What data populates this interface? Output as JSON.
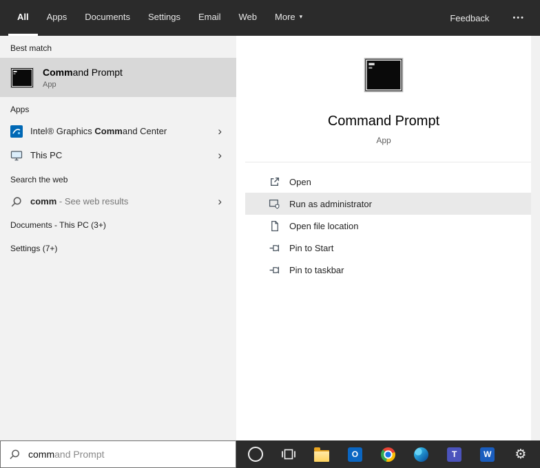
{
  "topbar": {
    "tabs": [
      {
        "label": "All",
        "active": true
      },
      {
        "label": "Apps"
      },
      {
        "label": "Documents"
      },
      {
        "label": "Settings"
      },
      {
        "label": "Email"
      },
      {
        "label": "Web"
      },
      {
        "label": "More",
        "caret": "▾"
      }
    ],
    "feedback_label": "Feedback",
    "more_options_glyph": "•••"
  },
  "left_panel": {
    "best_match_header": "Best match",
    "best_match": {
      "title_match": "Comm",
      "title_rest": "and Prompt",
      "subtitle": "App"
    },
    "apps_header": "Apps",
    "app_items": [
      {
        "pre": "Intel® Graphics ",
        "match": "Comm",
        "rest": "and Center",
        "chevron": "›"
      },
      {
        "pre": "This PC",
        "match": "",
        "rest": "",
        "chevron": "›"
      }
    ],
    "search_web_header": "Search the web",
    "search_web_item": {
      "match": "comm",
      "rest": " - See web results",
      "chevron": "›"
    },
    "group_headers": [
      {
        "label": "Documents - This PC (3+)"
      },
      {
        "label": "Settings (7+)"
      }
    ]
  },
  "right_panel": {
    "app_title": "Command Prompt",
    "app_subtitle": "App",
    "actions": [
      {
        "label": "Open"
      },
      {
        "label": "Run as administrator",
        "highlighted": true
      },
      {
        "label": "Open file location"
      },
      {
        "label": "Pin to Start"
      },
      {
        "label": "Pin to taskbar"
      }
    ]
  },
  "search_box": {
    "typed": "comm",
    "suggestion": "and Prompt"
  },
  "taskbar": {
    "icons": [
      {
        "name": "cortana"
      },
      {
        "name": "task-view"
      },
      {
        "name": "file-explorer"
      },
      {
        "name": "outlook",
        "letter": "O"
      },
      {
        "name": "chrome"
      },
      {
        "name": "edge"
      },
      {
        "name": "teams",
        "letter": "T"
      },
      {
        "name": "word",
        "letter": "W"
      },
      {
        "name": "settings",
        "glyph": "⚙"
      }
    ]
  }
}
